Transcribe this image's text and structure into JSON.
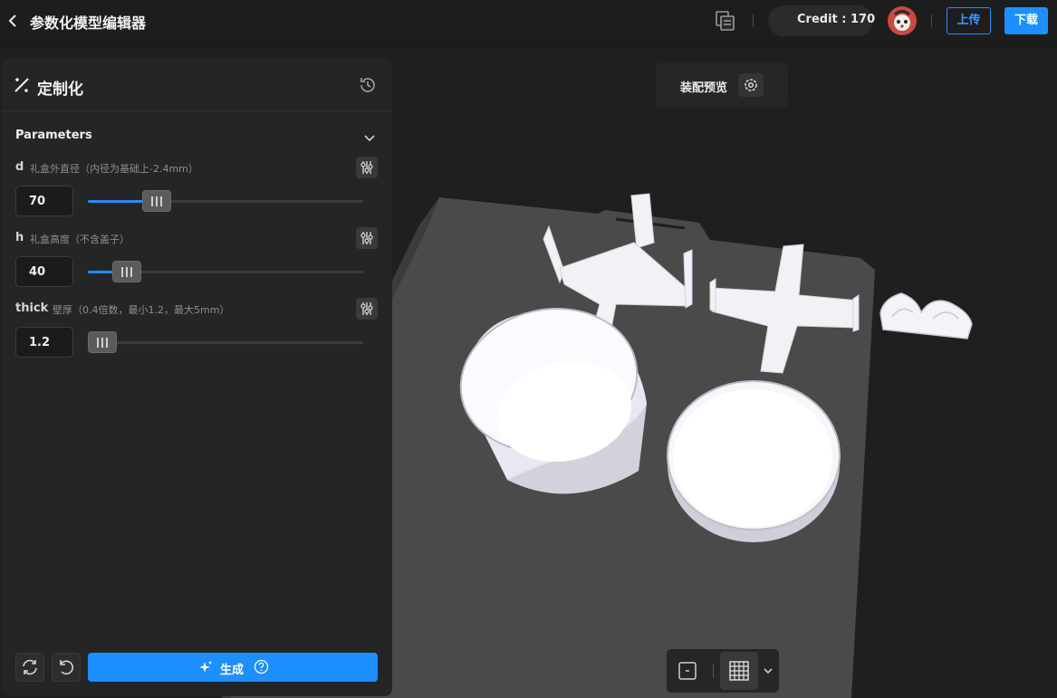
{
  "header": {
    "back_label": "‹",
    "title": "参数化模型编辑器",
    "credit_label": "Credit : 170",
    "upload_label": "上传",
    "download_label": "下载"
  },
  "viewport": {
    "preview_label": "装配预览"
  },
  "panel": {
    "title": "定制化",
    "section_title": "Parameters",
    "params": [
      {
        "name": "d",
        "desc": "礼盒外直径（内径为基础上-2.4mm）",
        "value": "70",
        "slider_fraction": 0.22
      },
      {
        "name": "h",
        "desc": "礼盒高度（不含盖子）",
        "value": "40",
        "slider_fraction": 0.1
      },
      {
        "name": "thick",
        "desc": "壁厚（0.4倍数，最小1.2，最大5mm）",
        "value": "1.2",
        "slider_fraction": 0.0
      }
    ],
    "generate_label": "生成"
  },
  "colors": {
    "accent": "#1e8fff",
    "panel_bg": "#252526",
    "canvas_bg": "#1f1f20",
    "plate": "#4b4b4c",
    "model": "#f5f5fb"
  }
}
